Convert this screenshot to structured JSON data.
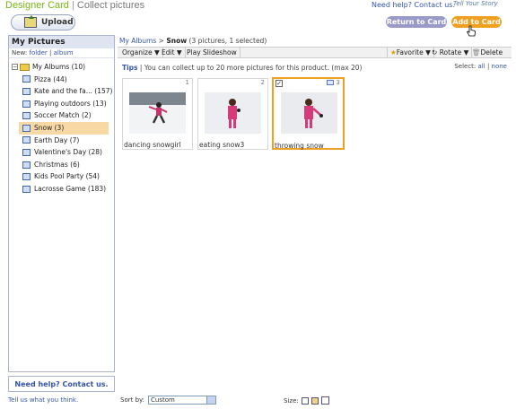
{
  "header": {
    "app_title": "Designer Card",
    "separator": "|",
    "page_title": "Collect pictures",
    "help_link": "Need help? Contact us.",
    "story_link": "Tell Your Story",
    "upload_label": "Upload",
    "return_label": "Return to Card",
    "add_label": "Add to Card"
  },
  "sidebar": {
    "title": "My Pictures",
    "new_label": "New:",
    "new_folder": "folder",
    "new_sep": "|",
    "new_album": "album",
    "root": "My Albums (10)",
    "albums": [
      {
        "label": "Pizza (44)"
      },
      {
        "label": "Kate and the fa... (157)"
      },
      {
        "label": "Playing outdoors (13)"
      },
      {
        "label": "Soccer Match (2)"
      },
      {
        "label": "Snow (3)"
      },
      {
        "label": "Earth Day (7)"
      },
      {
        "label": "Valentine's Day (28)"
      },
      {
        "label": "Christmas (6)"
      },
      {
        "label": "Kids Pool Party (54)"
      },
      {
        "label": "Lacrosse Game (183)"
      }
    ],
    "help_box": "Need help? Contact us.",
    "tell_us": "Tell us what you think."
  },
  "main": {
    "crumb_root": "My Albums",
    "crumb_sep": ">",
    "crumb_current": "Snow",
    "crumb_count": "(3 pictures, 1 selected)",
    "toolbar": {
      "organize": "Organize ▼",
      "edit": "Edit ▼",
      "slideshow": "Play Slideshow",
      "favorite": "Favorite ▼",
      "rotate": "Rotate ▼",
      "delete": "Delete"
    },
    "tips_label": "Tips",
    "tips_text": "| You can collect up to 20 more pictures for this product. (max 20)",
    "select_label": "Select:",
    "select_all": "all",
    "select_sep": "|",
    "select_none": "none",
    "pictures": [
      {
        "num": "1",
        "caption": "dancing snowgirl"
      },
      {
        "num": "2",
        "caption": "eating snow3"
      },
      {
        "num": "3",
        "caption": "throwing snow"
      }
    ]
  },
  "footer": {
    "sort_label": "Sort by:",
    "sort_value": "Custom",
    "size_label": "Size:"
  }
}
